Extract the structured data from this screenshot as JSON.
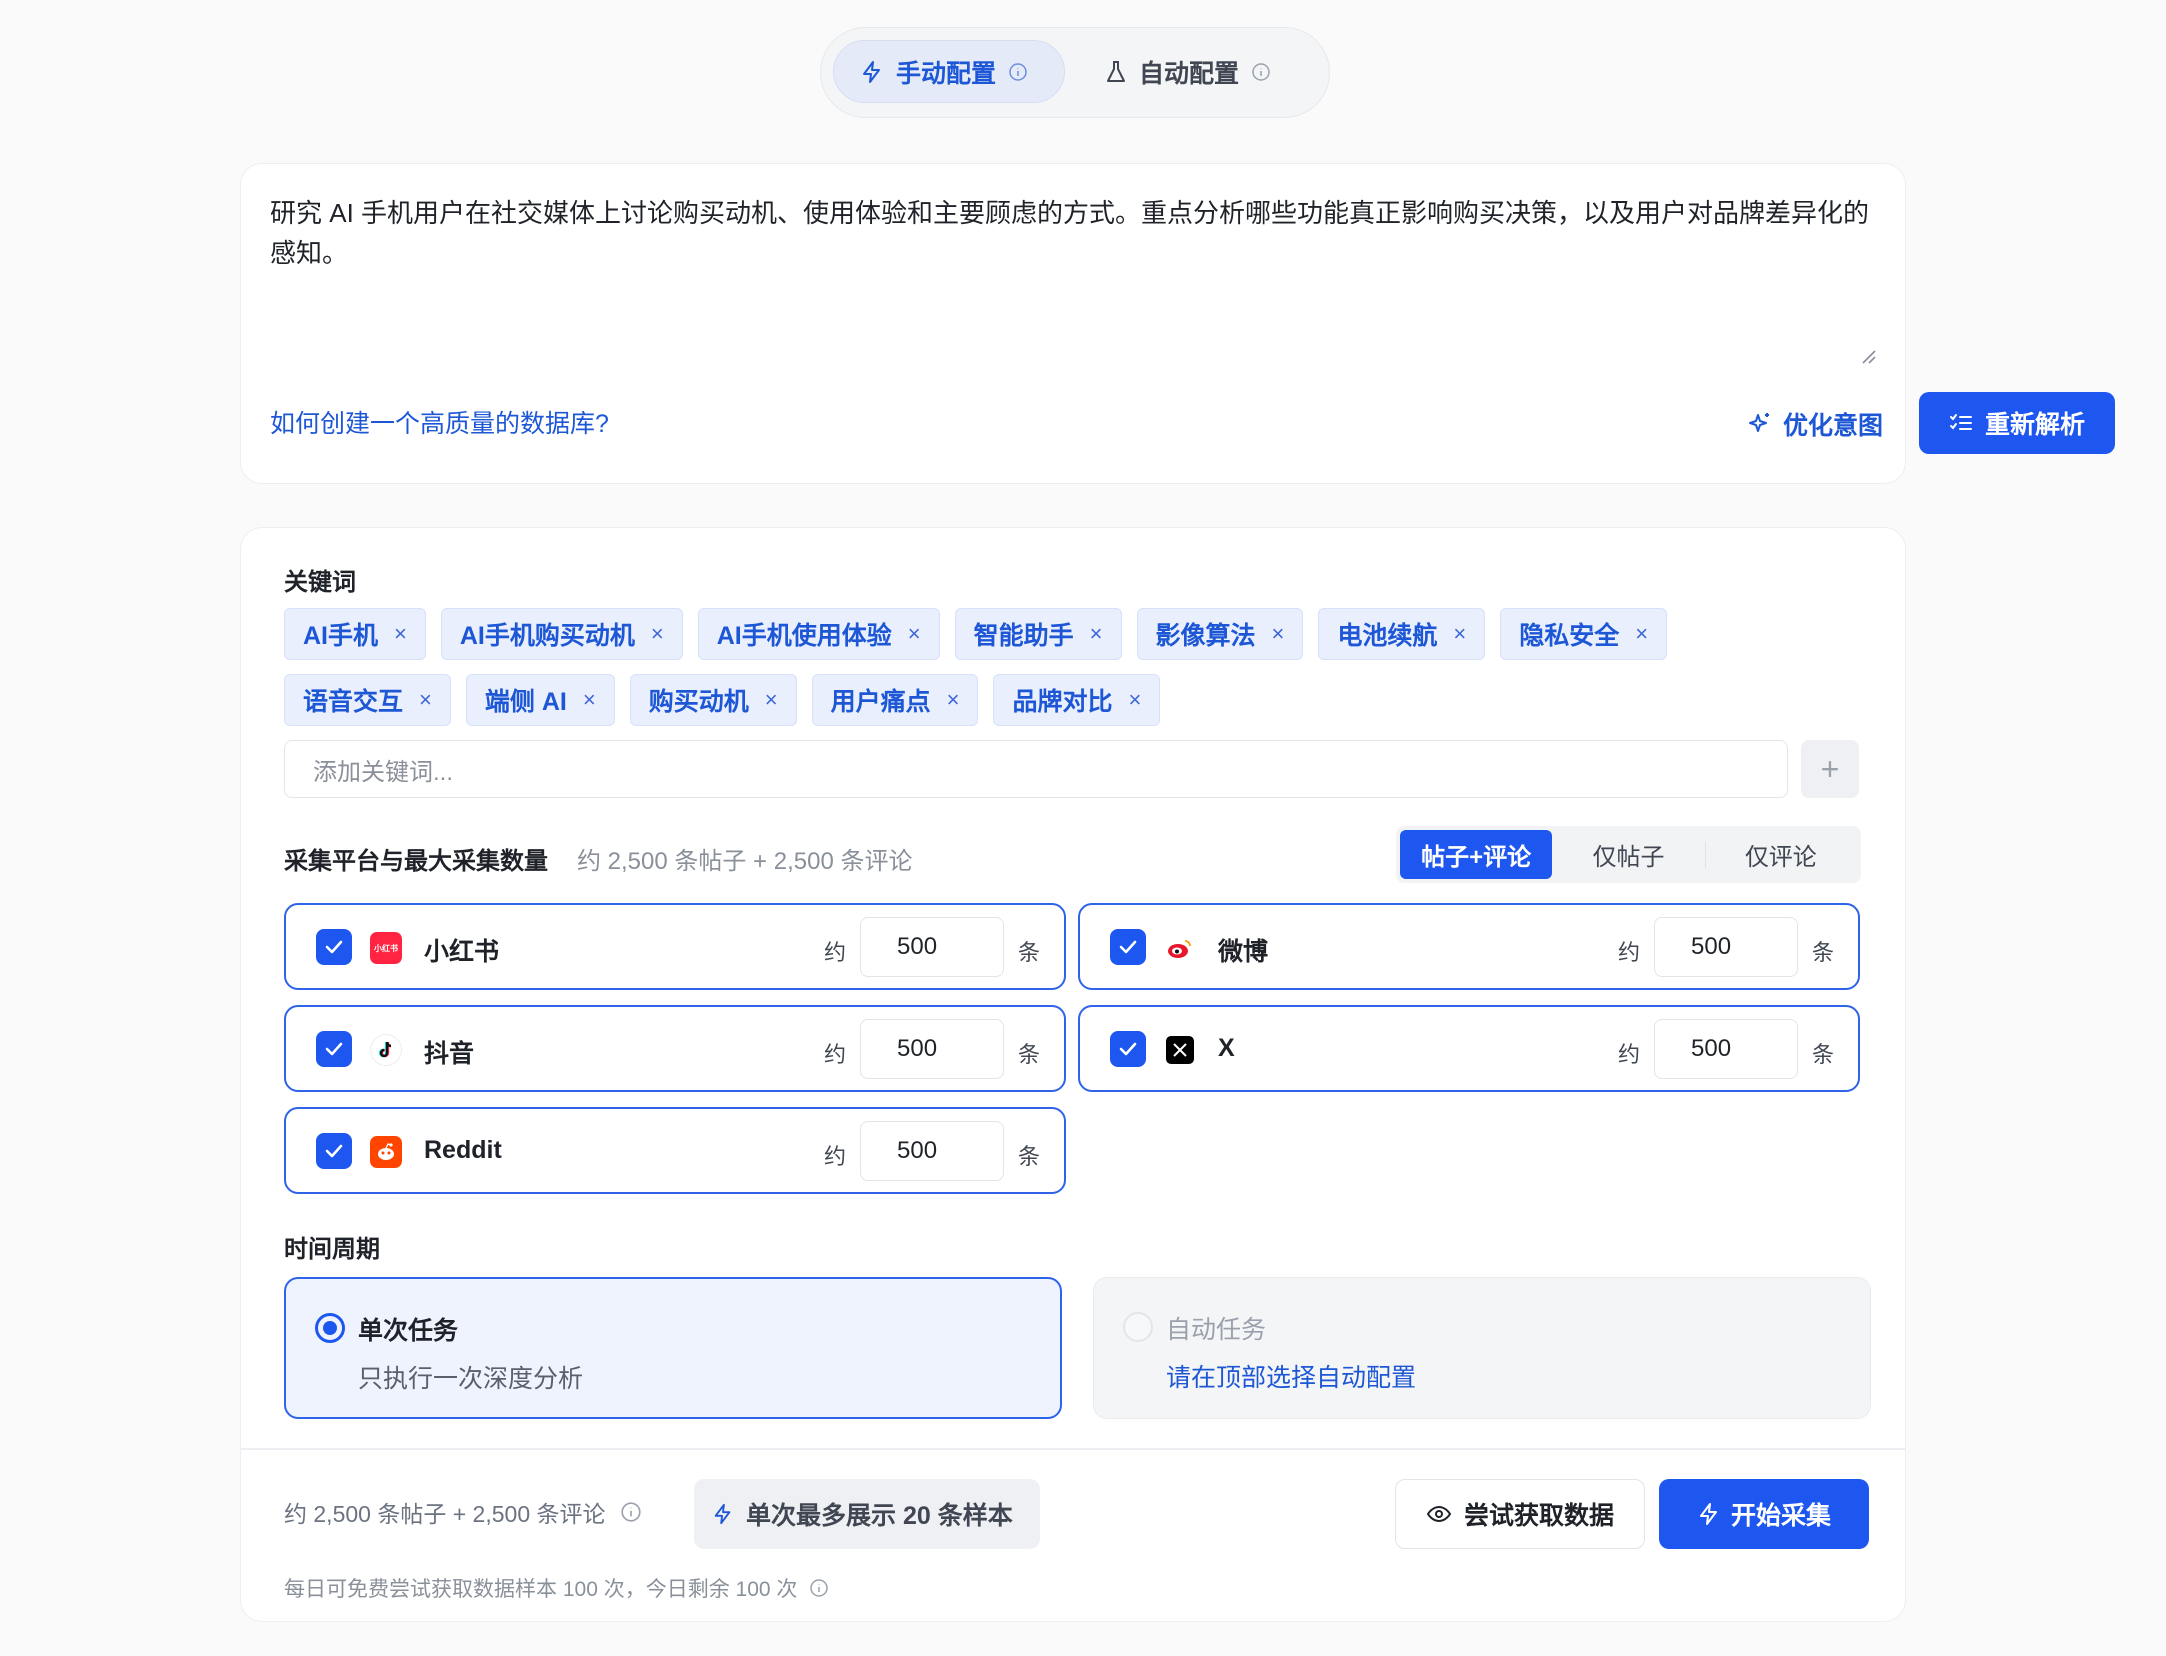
{
  "mode_switch": {
    "manual_label": "手动配置",
    "auto_label": "自动配置"
  },
  "prompt": {
    "text": "研究 AI 手机用户在社交媒体上讨论购买动机、使用体验和主要顾虑的方式。重点分析哪些功能真正影响购买决策，以及用户对品牌差异化的感知。",
    "help_link": "如何创建一个高质量的数据库?",
    "optimize_label": "优化意图",
    "reparse_label": "重新解析"
  },
  "keywords": {
    "title": "关键词",
    "row1": [
      "AI手机",
      "AI手机购买动机",
      "AI手机使用体验",
      "智能助手",
      "影像算法",
      "电池续航",
      "隐私安全"
    ],
    "row2": [
      "语音交互",
      "端侧 AI",
      "购买动机",
      "用户痛点",
      "品牌对比"
    ],
    "input_placeholder": "添加关键词...",
    "add_symbol": "+"
  },
  "platforms": {
    "title": "采集平台与最大采集数量",
    "subtitle": "约 2,500 条帖子 + 2,500 条评论",
    "segments": [
      "帖子+评论",
      "仅帖子",
      "仅评论"
    ],
    "active_segment": 0,
    "approx_label": "约",
    "unit_label": "条",
    "items": [
      {
        "name": "小红书",
        "count": "500",
        "checked": true,
        "logo_text": "小红书",
        "logo_color": "#ff2442"
      },
      {
        "name": "微博",
        "count": "500",
        "checked": true,
        "logo_color": "#e6162d"
      },
      {
        "name": "抖音",
        "count": "500",
        "checked": true,
        "logo_color": "#111111"
      },
      {
        "name": "X",
        "count": "500",
        "checked": true,
        "logo_color": "#000000"
      },
      {
        "name": "Reddit",
        "count": "500",
        "checked": true,
        "logo_color": "#ff4500"
      }
    ]
  },
  "period": {
    "title": "时间周期",
    "single": {
      "title": "单次任务",
      "desc": "只执行一次深度分析",
      "selected": true
    },
    "auto": {
      "title": "自动任务",
      "desc": "请在顶部选择自动配置",
      "selected": false
    }
  },
  "footer": {
    "estimate": "约 2,500 条帖子 + 2,500 条评论",
    "sample_label": "单次最多展示 20 条样本",
    "try_label": "尝试获取数据",
    "start_label": "开始采集",
    "quota": "每日可免费尝试获取数据样本 100 次，今日剩余 100 次"
  },
  "colors": {
    "primary": "#1d57f0",
    "chip_bg": "#e9effd",
    "chip_text": "#1d57d6"
  }
}
